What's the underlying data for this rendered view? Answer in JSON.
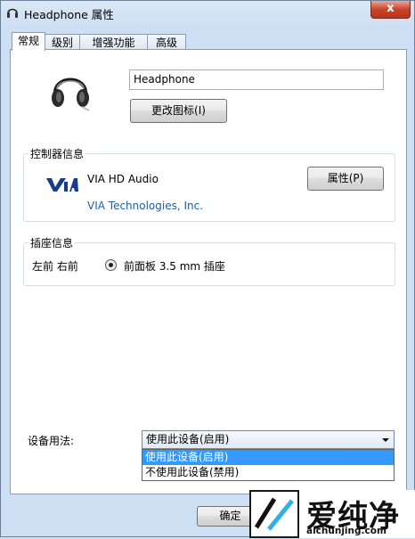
{
  "window": {
    "title": "Headphone 属性",
    "close_glyph": "x"
  },
  "tabs": [
    {
      "label": "常规",
      "active": true
    },
    {
      "label": "级别",
      "active": false
    },
    {
      "label": "增强功能",
      "active": false
    },
    {
      "label": "高级",
      "active": false
    }
  ],
  "general": {
    "device_name": "Headphone",
    "change_icon_label": "更改图标(I)",
    "device_icon": "headphone-icon"
  },
  "controller": {
    "group_label": "控制器信息",
    "name": "VIA HD Audio",
    "properties_label": "属性(P)",
    "vendor_link": "VIA Technologies, Inc.",
    "logo": "via-logo"
  },
  "jack": {
    "group_label": "插座信息",
    "position": "左前 右前",
    "description": "前面板 3.5 mm 插座"
  },
  "usage": {
    "label": "设备用法:",
    "selected": "使用此设备(启用)",
    "options": [
      "使用此设备(启用)",
      "不使用此设备(禁用)"
    ]
  },
  "footer": {
    "ok_label": "确定"
  },
  "watermark": {
    "text": "爱纯净",
    "url": "aichunjing.com"
  }
}
